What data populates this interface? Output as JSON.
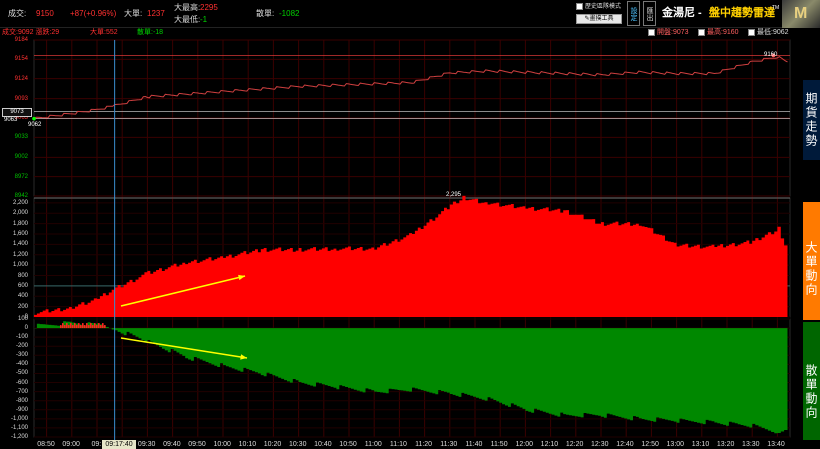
{
  "header": {
    "deal_label": "成交:",
    "deal_value": "9150",
    "change_value": "+87(+0.96%)",
    "big_order_label": "大單:",
    "big_order_value": "1237",
    "big_high_label": "大最高:",
    "big_high_value": "2295",
    "big_low_label": "大最低:",
    "big_low_value": "-1",
    "retail_label": "散單:",
    "retail_value": "-1082",
    "history_checkbox_label": "歷史區隊模式",
    "drawing_tool_label": "畫撲工具",
    "settings_button": "設定",
    "export_button": "匯出",
    "app_title": "金湯尼 - ",
    "app_subtitle": "盤中趨勢雷達",
    "trademark": "TM",
    "logo_mark": "M"
  },
  "sub_header": {
    "deal_text": "成交:9092 漲跌:29",
    "big_text": "大單:552",
    "retail_text": "散單:-18",
    "legend_prev_close": "開盤:9073",
    "legend_high": "最高:9160",
    "legend_low": "最低:9062"
  },
  "right_nav": {
    "futures_trend": "期貨走勢",
    "big_order_direction": "大單動向",
    "retail_direction": "散單動向"
  },
  "price_axis": [
    "9184",
    "9154",
    "9124",
    "9093",
    "9063",
    "9033",
    "9002",
    "8972",
    "8942"
  ],
  "price_axis_markers": {
    "left_box": "9073",
    "open_value": "9063",
    "low_label": "9062",
    "high_label": "9160"
  },
  "big_axis": [
    "2,200",
    "2,000",
    "1,800",
    "1,600",
    "1,400",
    "1,200",
    "1,000",
    "800",
    "600",
    "400",
    "200",
    "0"
  ],
  "big_peak_label": "2,295",
  "retail_axis": [
    "100",
    "0",
    "-100",
    "-200",
    "-300",
    "-400",
    "-500",
    "-600",
    "-700",
    "-800",
    "-900",
    "-1,000",
    "-1,100",
    "-1,200"
  ],
  "time_axis": [
    "08:50",
    "09:00",
    "09:",
    "09:17:40",
    "09:30",
    "09:40",
    "09:50",
    "10:00",
    "10:10",
    "10:20",
    "10:30",
    "10:40",
    "10:50",
    "11:00",
    "11:10",
    "11:20",
    "11:30",
    "11:40",
    "11:50",
    "12:00",
    "12:10",
    "12:20",
    "12:30",
    "12:40",
    "12:50",
    "13:00",
    "13:10",
    "13:20",
    "13:30",
    "13:40"
  ],
  "colors": {
    "price_up": "#ff3030",
    "price_down": "#00c000",
    "big_fill": "#ff0000",
    "retail_fill": "#008800",
    "grid": "#3a0000",
    "cursor": "#3a8fd0",
    "arrow": "#ffff00",
    "nav_bg_top": "#001a3a",
    "nav_bg_mid": "#ff7a00",
    "nav_bg_bottom": "#006600"
  },
  "chart_data": [
    {
      "type": "line",
      "title": "期貨走勢",
      "x": [
        "08:45",
        "09:00",
        "09:10",
        "09:17",
        "09:30",
        "09:45",
        "10:00",
        "10:15",
        "10:30",
        "10:45",
        "11:00",
        "11:15",
        "11:30",
        "11:45",
        "12:00",
        "12:15",
        "12:30",
        "12:45",
        "13:00",
        "13:15",
        "13:30",
        "13:40",
        "13:44"
      ],
      "series": [
        {
          "values": [
            9062,
            9070,
            9076,
            9082,
            9096,
            9100,
            9104,
            9108,
            9112,
            9114,
            9116,
            9118,
            9133,
            9136,
            9134,
            9132,
            9130,
            9134,
            9132,
            9132,
            9150,
            9158,
            9150
          ]
        }
      ],
      "ylim": [
        8942,
        9184
      ]
    },
    {
      "type": "area",
      "title": "大單動向",
      "x": [
        "08:45",
        "09:00",
        "09:10",
        "09:17",
        "09:30",
        "09:45",
        "10:00",
        "10:15",
        "10:30",
        "10:45",
        "11:00",
        "11:15",
        "11:30",
        "11:35",
        "11:45",
        "12:00",
        "12:15",
        "12:30",
        "12:45",
        "13:00",
        "13:15",
        "13:30",
        "13:40",
        "13:44"
      ],
      "series": [
        {
          "values": [
            80,
            180,
            350,
            550,
            850,
            1050,
            1150,
            1300,
            1300,
            1320,
            1320,
            1600,
            2150,
            2295,
            2200,
            2100,
            2050,
            1800,
            1800,
            1380,
            1350,
            1450,
            1700,
            1237
          ]
        }
      ],
      "ylim": [
        0,
        2295
      ]
    },
    {
      "type": "area",
      "title": "散單動向",
      "x": [
        "08:45",
        "09:00",
        "09:10",
        "09:17",
        "09:30",
        "09:45",
        "10:00",
        "10:15",
        "10:30",
        "10:45",
        "11:00",
        "11:15",
        "11:30",
        "11:45",
        "12:00",
        "12:15",
        "12:30",
        "12:45",
        "13:00",
        "13:15",
        "13:30",
        "13:40",
        "13:44"
      ],
      "series": [
        {
          "values": [
            20,
            60,
            30,
            -18,
            -150,
            -320,
            -420,
            -500,
            -600,
            -650,
            -700,
            -680,
            -720,
            -780,
            -900,
            -960,
            -960,
            -1000,
            -1020,
            -1040,
            -1080,
            -1150,
            -1082
          ]
        }
      ],
      "ylim": [
        -1200,
        100
      ]
    }
  ]
}
